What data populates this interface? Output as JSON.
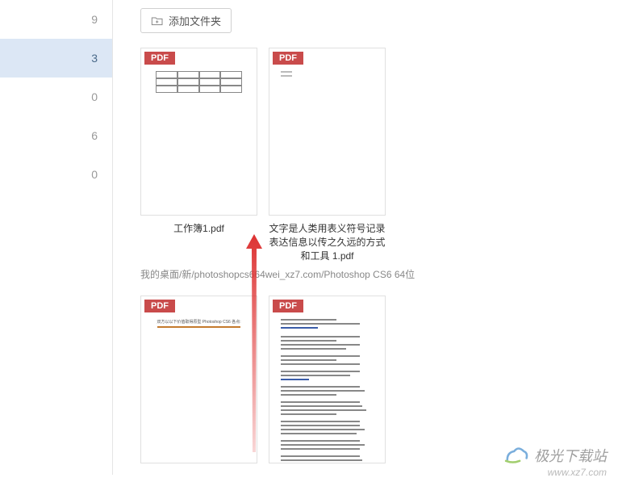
{
  "sidebar": {
    "items": [
      {
        "label": "...",
        "count": "9"
      },
      {
        "label": "",
        "count": "3",
        "selected": true
      },
      {
        "label": "",
        "count": "0"
      },
      {
        "label": "",
        "count": "6"
      },
      {
        "label": "...",
        "count": "0"
      }
    ]
  },
  "toolbar": {
    "add_folder_label": "添加文件夹"
  },
  "breadcrumb": "我的桌面/新/photoshopcs664wei_xz7.com/Photoshop CS6 64位",
  "files": {
    "row1": [
      {
        "badge": "PDF",
        "name": "工作簿1.pdf"
      },
      {
        "badge": "PDF",
        "name": "文字是人类用表义符号记录表达信息以传之久远的方式和工具 1.pdf"
      }
    ],
    "row2": [
      {
        "badge": "PDF"
      },
      {
        "badge": "PDF"
      }
    ]
  },
  "watermark": {
    "text": "极光下载站",
    "url": "www.xz7.com"
  }
}
